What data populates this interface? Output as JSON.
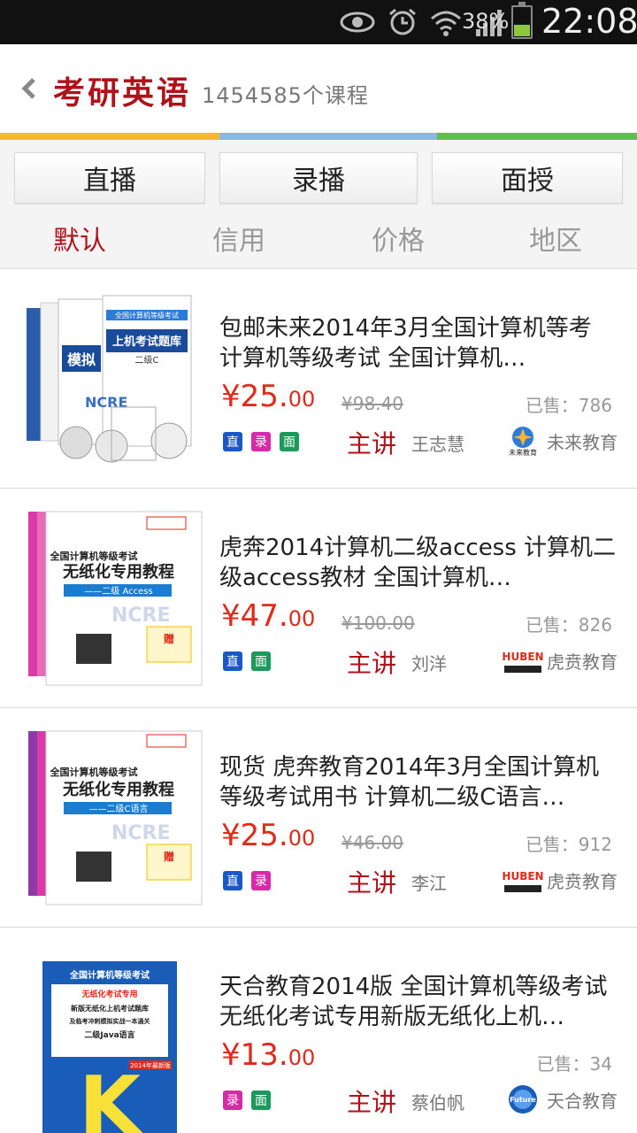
{
  "status_bar": {
    "battery_percent": "38%",
    "battery_level": 0.38,
    "time": "22:08",
    "icons": [
      "eye-icon",
      "alarm-icon",
      "wifi-icon",
      "signal-icon",
      "battery-icon"
    ]
  },
  "header": {
    "title": "考研英语",
    "subtitle": "1454585个课程"
  },
  "colors": {
    "accent": "#b0121b",
    "price": "#e02a1a",
    "stripe": [
      "#f7b731",
      "#8ab6e8",
      "#5ac24b"
    ]
  },
  "tabs": [
    {
      "label": "直播"
    },
    {
      "label": "录播"
    },
    {
      "label": "面授"
    }
  ],
  "sort": [
    {
      "label": "默认",
      "active": true
    },
    {
      "label": "信用"
    },
    {
      "label": "价格"
    },
    {
      "label": "地区"
    }
  ],
  "lecturer_prefix": "主讲",
  "tag_labels": {
    "zhi": "直",
    "lu": "录",
    "mian": "面"
  },
  "items": [
    {
      "title": "包邮未来2014年3月全国计算机等考 计算机等级考试 全国计算机…",
      "price_int": "¥25.",
      "price_dec": "00",
      "old_price": "¥98.40",
      "sold": "已售：786",
      "lecturer": "王志慧",
      "org": "未来教育",
      "org_logo_text": "未来教育",
      "cover_text": [
        "全国计算机等级考试",
        "模拟",
        "上机考试题库",
        "二级C",
        "NCRE"
      ]
    },
    {
      "title": "虎奔2014计算机二级access 计算机二级access教材 全国计算机…",
      "price_int": "¥47.",
      "price_dec": "00",
      "old_price": "¥100.00",
      "sold": "已售：826",
      "lecturer": "刘洋",
      "org": "虎贲教育",
      "org_logo_text": "HUBEN",
      "cover_text": [
        "全国计算机等级考试",
        "无纸化专用教程",
        "——二级 Access",
        "NCRE",
        "赠"
      ]
    },
    {
      "title": "现货 虎奔教育2014年3月全国计算机等级考试用书 计算机二级C语言…",
      "price_int": "¥25.",
      "price_dec": "00",
      "old_price": "¥46.00",
      "sold": "已售：912",
      "lecturer": "李江",
      "org": "虎贲教育",
      "org_logo_text": "HUBEN",
      "cover_text": [
        "全国计算机等级考试",
        "无纸化专用教程",
        "——二级C语言",
        "NCRE",
        "赠"
      ]
    },
    {
      "title": "天合教育2014版 全国计算机等级考试 无纸化考试专用新版无纸化上机…",
      "price_int": "¥13.",
      "price_dec": "00",
      "old_price": "",
      "sold": "已售：34",
      "lecturer": "蔡伯帆",
      "org": "天合教育",
      "org_logo_text": "Future",
      "cover_text": [
        "全国计算机等级考试",
        "无纸化考试专用",
        "新版无纸化上机考试题库",
        "及临考冲刺模拟实战一本通关",
        "二级Java语言",
        "2014年最新版",
        "K"
      ]
    }
  ]
}
